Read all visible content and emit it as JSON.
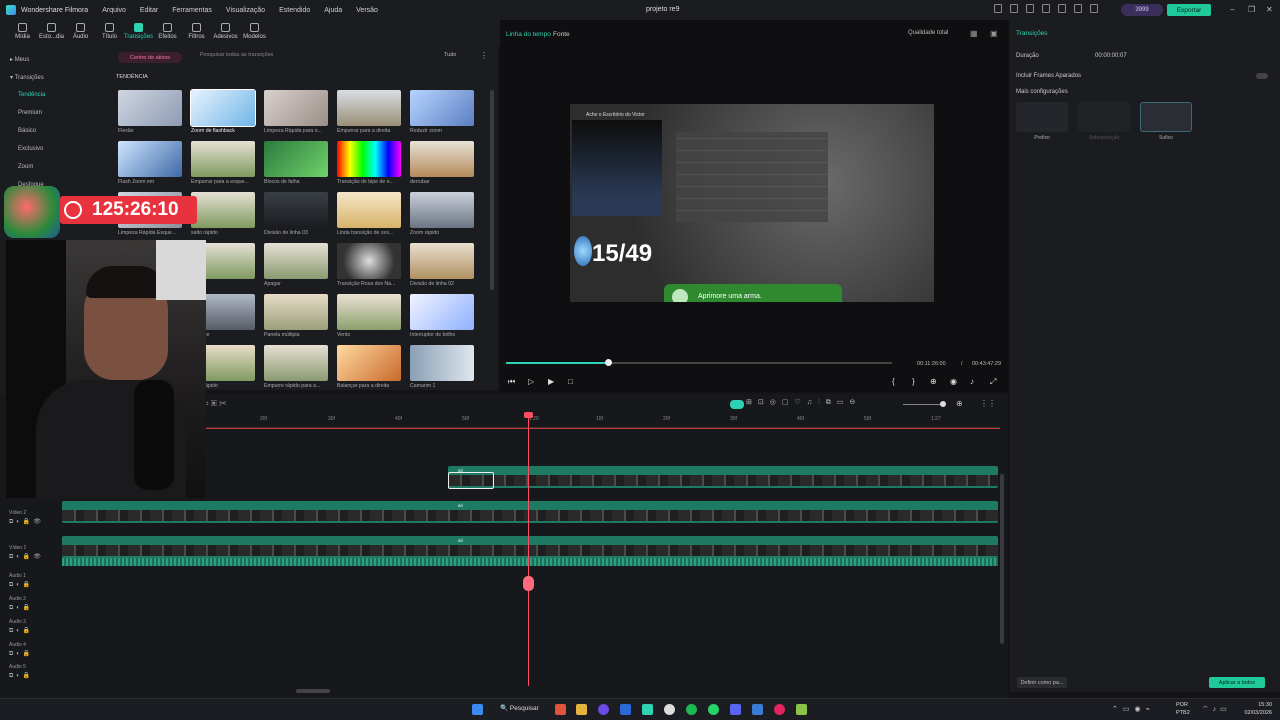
{
  "app": {
    "name": "Wondershare Filmora",
    "menu": [
      "Arquivo",
      "Editar",
      "Ferramentas",
      "Visualização",
      "Estendido",
      "Ajuda",
      "Versão"
    ],
    "project_title": "projeto re9",
    "credits": "3999",
    "export_label": "Exportar"
  },
  "toolbar": [
    {
      "label": "Mídia"
    },
    {
      "label": "Esto...dia"
    },
    {
      "label": "Áudio"
    },
    {
      "label": "Título"
    },
    {
      "label": "Transições"
    },
    {
      "label": "Efeitos"
    },
    {
      "label": "Filtros"
    },
    {
      "label": "Adesivos"
    },
    {
      "label": "Modelos"
    }
  ],
  "leftnav": {
    "items": [
      "Meus",
      "Transições",
      "Tendência",
      "Premium",
      "Básico",
      "Exclusivo",
      "Zoom",
      "Desfoque"
    ]
  },
  "library": {
    "asset_center": "Centro de ativos",
    "search_placeholder": "Pesquisar todas as transições",
    "filter": "Tudo",
    "section": "TENDÊNCIA",
    "thumbs": [
      "Flexão",
      "Zoom de flashback",
      "Limpeza Rápida para o...",
      "Empurrar para a direita",
      "Reduzir zoom",
      "Flash Zoom em",
      "Empurrar para a esque...",
      "Blocos de falha",
      "Transição de bipe de e...",
      "derrubar",
      "Limpeza Rápida Esque...",
      "salto rápido",
      "Divisão de linha 03",
      "Linda transição de ces...",
      "Zoom rápido",
      "",
      "rápido",
      "Apagar",
      "Transição Rosa dos Na...",
      "Divisão de linha 02",
      "",
      "da lente",
      "Panela múltipla",
      "Vento",
      "Interruptor de brilho",
      "",
      "flash rápido",
      "Empurre rápido para a...",
      "Balançar para a direita",
      "Camarim 1"
    ]
  },
  "preview": {
    "tab_timeline": "Linha do tempo",
    "tab_source": "Fonte",
    "quality": "Qualidade total",
    "overlay_title": "Acho o Escritório do Victor",
    "counter": "15/49",
    "toast": "Aprimore uma arma.",
    "current_time": "00:11:26:00",
    "separator": "/",
    "total_time": "00:43:47:29"
  },
  "right_panel": {
    "title": "Transições",
    "duration_label": "Duração",
    "duration_value": "00:00:00:07",
    "include_frames": "Incluir Frames Aparados",
    "more_settings": "Mais configurações",
    "modes": [
      "Prefixo",
      "Sobreposição",
      "Sufixo"
    ],
    "define_default": "Definir como pa...",
    "apply_all": "Aplicar a todos"
  },
  "timeline": {
    "ticks": [
      "20f",
      "30f",
      "40f",
      "50f",
      "1:20",
      "10f",
      "20f",
      "30f",
      "40f",
      "50f",
      "1:27"
    ],
    "tracks": [
      "Vídeo 2",
      "Vídeo 1",
      "Áudio 1",
      "Áudio 2",
      "Áudio 3",
      "Áudio 4",
      "Áudio 5"
    ],
    "clip_label": "ari"
  },
  "overlay": {
    "timer": "125:26:10"
  },
  "taskbar": {
    "search": "Pesquisar",
    "lang": "POR",
    "lang2": "PTB2",
    "time": "15:30",
    "date": "02/03/2026"
  },
  "colors": {
    "accent": "#2fd3b4",
    "export": "#20c99a",
    "playhead": "#ff4e64",
    "clip": "#1f7a63",
    "timer": "#e8323e"
  }
}
